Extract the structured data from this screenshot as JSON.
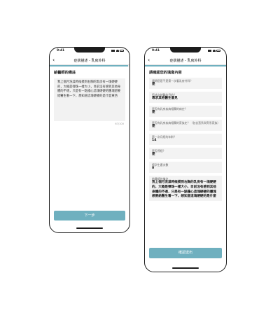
{
  "status": {
    "time": "9:41"
  },
  "screen1": {
    "nav_title": "症狀描述 - 乳房外科",
    "back_icon": "chevron-left-icon",
    "progress": 0.98,
    "section_title": "給醫師的備註",
    "textarea_text": "我上個月洗澡時候摸到右胸的乳房有一塊硬硬的，大概是彈珠一樣大小，目前沒有感到其他身體的不適，只是有一點擔心這塊硬硬的腫塊想要給醫生看一下，想知道這塊硬硬的是什麼東西",
    "counter": "67/100",
    "next_label": "下一步"
  },
  "screen2": {
    "nav_title": "症狀描述 - 乳房外科",
    "back_icon": "chevron-left-icon",
    "progress": 1.0,
    "section_title": "請確認您的填寫內容",
    "items": [
      {
        "q": "請問您是不是第一次看乳房外科？",
        "a": "是"
      },
      {
        "q": "您這次就醫的目的？",
        "a": "尋求其他醫生意見"
      },
      {
        "q": "是否有乳房疾病相關的病史？",
        "a": "是"
      },
      {
        "q": "是否有乳房疾病相關的家族史？（包含直系與旁系家族）",
        "a": "是"
      },
      {
        "q": "第一次月經的年齡？",
        "a": "14"
      },
      {
        "q": "是否停經？",
        "a": "是"
      },
      {
        "q": "懷孕生產次數",
        "a": "0"
      },
      {
        "q": "給醫師的備註",
        "a": "我上個月洗澡時候摸到右胸的乳房有一塊硬硬的，大概是彈珠一樣大小，目前沒有感到其他身體的不適，只是有一點擔心這塊硬硬的腫塊想要給醫生看一下，想知道這塊硬硬的是什麼"
      }
    ],
    "confirm_label": "確認送出"
  },
  "colors": {
    "accent": "#6fb0bf",
    "field_bg": "#f2f2f2",
    "frame": "#1d1d1d"
  }
}
